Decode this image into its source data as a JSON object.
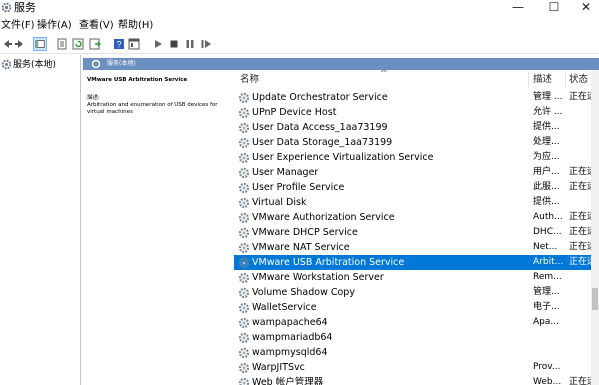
{
  "window": {
    "title": "服务",
    "minimize_glyph": "—",
    "maximize_glyph": "☐",
    "close_glyph": "✕"
  },
  "menu": {
    "items": [
      {
        "label": "文件(F)"
      },
      {
        "label": "操作(A)"
      },
      {
        "label": "查看(V)"
      },
      {
        "label": "帮助(H)"
      }
    ]
  },
  "toolbar": {
    "buttons": [
      "back-icon",
      "forward-icon",
      "console-tree-icon",
      "properties-icon",
      "refresh-icon",
      "export-icon",
      "help-icon",
      "view-icon",
      "start-icon",
      "stop-icon",
      "pause-icon",
      "restart-icon"
    ]
  },
  "tree": {
    "root_label": "服务(本地)"
  },
  "band": {
    "title": "服务(本地)"
  },
  "details": {
    "service_title": "VMware USB Arbitration Service",
    "description_label": "描述:",
    "description_text": "Arbitration and enumeration of USB devices for virtual machines"
  },
  "list": {
    "columns": {
      "name": "名称",
      "description": "描述",
      "status": "状态"
    },
    "selected_index": 11,
    "services": [
      {
        "name": "Update Orchestrator Service",
        "description": "管理 ...",
        "status": "正在运"
      },
      {
        "name": "UPnP Device Host",
        "description": "允许 ...",
        "status": ""
      },
      {
        "name": "User Data Access_1aa73199",
        "description": "提供...",
        "status": ""
      },
      {
        "name": "User Data Storage_1aa73199",
        "description": "处理...",
        "status": ""
      },
      {
        "name": "User Experience Virtualization Service",
        "description": "为应...",
        "status": ""
      },
      {
        "name": "User Manager",
        "description": "用户...",
        "status": "正在运"
      },
      {
        "name": "User Profile Service",
        "description": "此服...",
        "status": "正在运"
      },
      {
        "name": "Virtual Disk",
        "description": "提供...",
        "status": ""
      },
      {
        "name": "VMware Authorization Service",
        "description": "Auth...",
        "status": "正在运"
      },
      {
        "name": "VMware DHCP Service",
        "description": "DHC...",
        "status": "正在运"
      },
      {
        "name": "VMware NAT Service",
        "description": "Net...",
        "status": "正在运"
      },
      {
        "name": "VMware USB Arbitration Service",
        "description": "Arbit...",
        "status": "正在运"
      },
      {
        "name": "VMware Workstation Server",
        "description": "Rem...",
        "status": ""
      },
      {
        "name": "Volume Shadow Copy",
        "description": "管理...",
        "status": ""
      },
      {
        "name": "WalletService",
        "description": "电子...",
        "status": ""
      },
      {
        "name": "wampapache64",
        "description": "Apa...",
        "status": ""
      },
      {
        "name": "wampmariadb64",
        "description": "",
        "status": ""
      },
      {
        "name": "wampmysqld64",
        "description": "",
        "status": ""
      },
      {
        "name": "WarpJITSvc",
        "description": "Prov...",
        "status": ""
      },
      {
        "name": "Web 帐户管理器",
        "description": "Web...",
        "status": "正在运"
      }
    ]
  },
  "colors": {
    "selection": "#0078d7",
    "band": "#6b8fbf"
  }
}
